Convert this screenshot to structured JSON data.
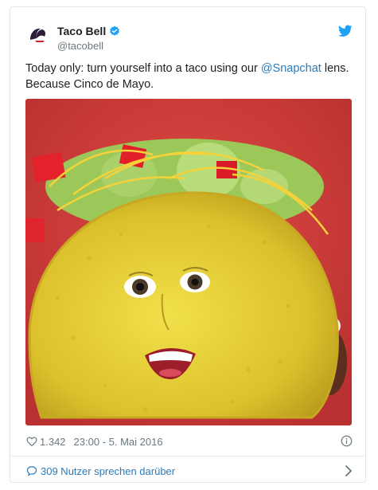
{
  "account": {
    "name": "Taco Bell",
    "handle": "@tacobell"
  },
  "tweet": {
    "text_before": "Today only: turn yourself into a taco using our ",
    "mention": "@Snapchat",
    "text_after": " lens. Because Cinco de Mayo."
  },
  "meta": {
    "likes": "1.342",
    "timestamp": "23:00 - 5. Mai 2016"
  },
  "footer": {
    "conversation_label": "309 Nutzer sprechen darüber"
  },
  "colors": {
    "link": "#2b7bb9",
    "muted": "#697882",
    "twitter_blue": "#1da1f2",
    "media_bg": "#cc3b3d"
  },
  "icons": [
    "taco-bell-logo-icon",
    "verified-icon",
    "twitter-bird-icon",
    "heart-icon",
    "info-icon",
    "speech-bubble-icon",
    "chevron-right-icon"
  ]
}
